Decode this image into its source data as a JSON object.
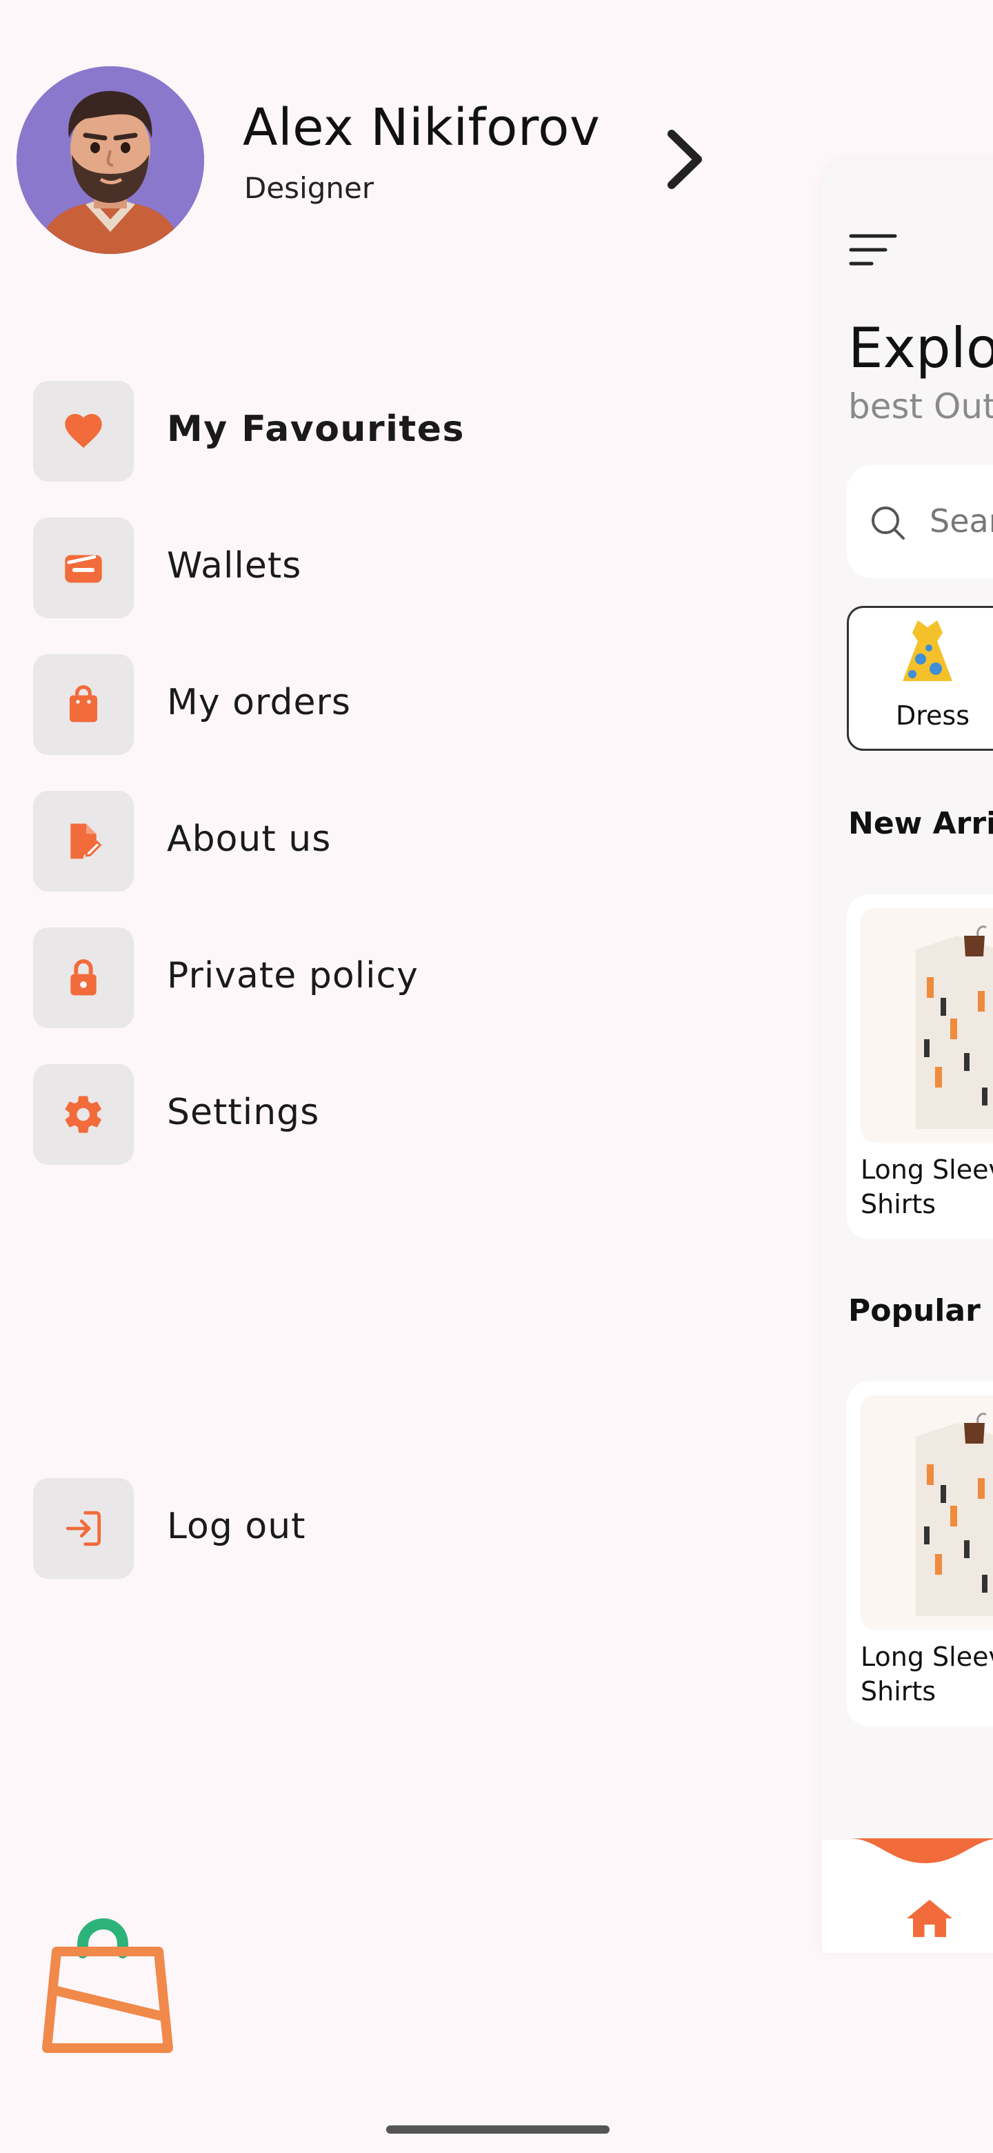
{
  "profile": {
    "name": "Alex Nikiforov",
    "role": "Designer"
  },
  "menu": {
    "items": [
      {
        "label": "My Favourites",
        "icon": "heart-icon",
        "bold": true
      },
      {
        "label": "Wallets",
        "icon": "wallet-icon"
      },
      {
        "label": "My orders",
        "icon": "shopping-bag-icon"
      },
      {
        "label": "About us",
        "icon": "document-edit-icon"
      },
      {
        "label": "Private policy",
        "icon": "lock-icon"
      },
      {
        "label": "Settings",
        "icon": "gear-icon"
      }
    ],
    "logout": {
      "label": "Log out",
      "icon": "login-arrow-icon"
    }
  },
  "main": {
    "title": "Explor",
    "subtitle": "best Outf",
    "search_placeholder": "Sear",
    "categories": [
      {
        "label": "Dress",
        "icon": "dress-icon"
      }
    ],
    "sections": {
      "new_arrivals": "New Arriva",
      "popular": "Popular"
    },
    "products": [
      {
        "name_line1": "Long Sleev",
        "name_line2": "Shirts"
      },
      {
        "name_line1": "Long Sleev",
        "name_line2": "Shirts"
      }
    ],
    "nav": {
      "active": "home-icon"
    }
  },
  "colors": {
    "accent": "#F26B3A",
    "icon_box": "#E9E7E8",
    "background": "#FDF7FA",
    "avatar_bg": "#8A78CC",
    "logo_orange": "#F0894A",
    "logo_green": "#2DB37A"
  }
}
